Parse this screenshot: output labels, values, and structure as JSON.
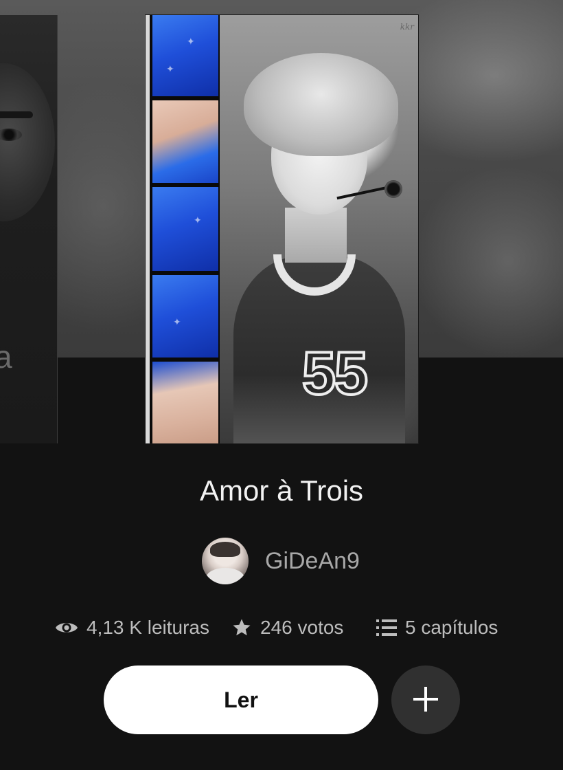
{
  "carousel": {
    "previous_cover": {
      "visible_letter": "a",
      "kind": "book-cover-partial"
    },
    "current_cover": {
      "kind": "book-cover",
      "jersey_number": "55",
      "strip_color": "#1f4fd9",
      "signature": "kkr"
    }
  },
  "story": {
    "title": "Amor à Trois",
    "author": {
      "name": "GiDeAn9",
      "avatar_icon": "author-avatar"
    }
  },
  "stats": {
    "reads": {
      "icon": "eye-icon",
      "label": "4,13 K leituras"
    },
    "votes": {
      "icon": "star-icon",
      "label": "246 votos"
    },
    "chapters": {
      "icon": "list-icon",
      "label": "5 capítulos"
    }
  },
  "actions": {
    "read_label": "Ler",
    "add_icon": "plus-icon"
  },
  "colors": {
    "background": "#121212",
    "text_primary": "#f2f2f2",
    "text_secondary": "#bdbdbd",
    "read_button": "#ffffff",
    "add_button": "#303030"
  }
}
